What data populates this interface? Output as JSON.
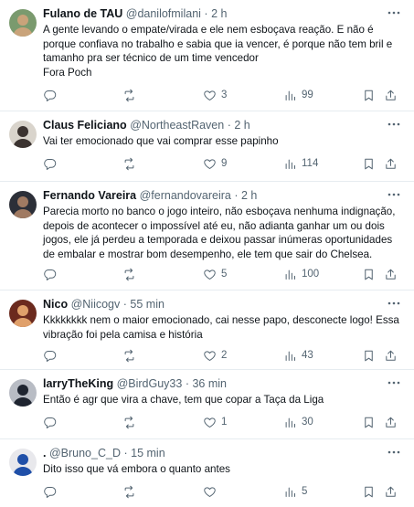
{
  "tweets": [
    {
      "name": "Fulano de TAU",
      "handle": "@danilofmilani",
      "sep": "·",
      "time": "2 h",
      "lines": [
        "A gente levando o empate/virada e ele nem esboçava reação. E não é",
        "porque confiava no trabalho e sabia que ia vencer, é porque não tem bril e",
        "tamanho pra ser técnico de um time vencedor",
        "Fora Poch"
      ],
      "reply_count": "",
      "retweet_count": "",
      "like_count": "3",
      "view_count": "99",
      "avatar_colors": [
        "#7a9a6e",
        "#c9a37a"
      ]
    },
    {
      "name": "Claus Feliciano",
      "handle": "@NortheastRaven",
      "sep": "·",
      "time": "2 h",
      "lines": [
        "Vai ter emocionado que vai comprar esse papinho"
      ],
      "reply_count": "",
      "retweet_count": "",
      "like_count": "9",
      "view_count": "114",
      "avatar_colors": [
        "#d9d4cc",
        "#3b3330"
      ]
    },
    {
      "name": "Fernando Vareira",
      "handle": "@fernandovareira",
      "sep": "·",
      "time": "2 h",
      "lines": [
        "Parecia morto no banco o jogo inteiro, não esboçava nenhuma indignação,",
        "depois de acontecer o impossível até eu, não adianta ganhar um ou dois",
        "jogos, ele já perdeu a temporada e deixou passar inúmeras oportunidades",
        "de embalar e mostrar bom desempenho, ele tem que sair do Chelsea."
      ],
      "reply_count": "",
      "retweet_count": "",
      "like_count": "5",
      "view_count": "100",
      "avatar_colors": [
        "#2c2f38",
        "#a07a62"
      ]
    },
    {
      "name": "Nico",
      "handle": "@Niicogv",
      "sep": "·",
      "time": "55 min",
      "lines": [
        "Kkkkkkkk nem o maior emocionado, cai nesse papo, desconecte logo! Essa",
        "vibração foi pela camisa e história"
      ],
      "reply_count": "",
      "retweet_count": "",
      "like_count": "2",
      "view_count": "43",
      "avatar_colors": [
        "#6b2a1e",
        "#e0a06a"
      ]
    },
    {
      "name": "larryTheKing",
      "handle": "@BirdGuy33",
      "sep": "·",
      "time": "36 min",
      "lines": [
        "Então é agr que vira a chave, tem que copar a Taça da Liga"
      ],
      "reply_count": "",
      "retweet_count": "",
      "like_count": "1",
      "view_count": "30",
      "avatar_colors": [
        "#b8bcc4",
        "#1e2430"
      ]
    },
    {
      "name": ".",
      "handle": "@Bruno_C_D",
      "sep": "·",
      "time": "15 min",
      "lines": [
        "Dito isso que vá embora o quanto antes"
      ],
      "reply_count": "",
      "retweet_count": "",
      "like_count": "",
      "view_count": "5",
      "avatar_colors": [
        "#e8e8ec",
        "#1f4fa8"
      ]
    }
  ]
}
